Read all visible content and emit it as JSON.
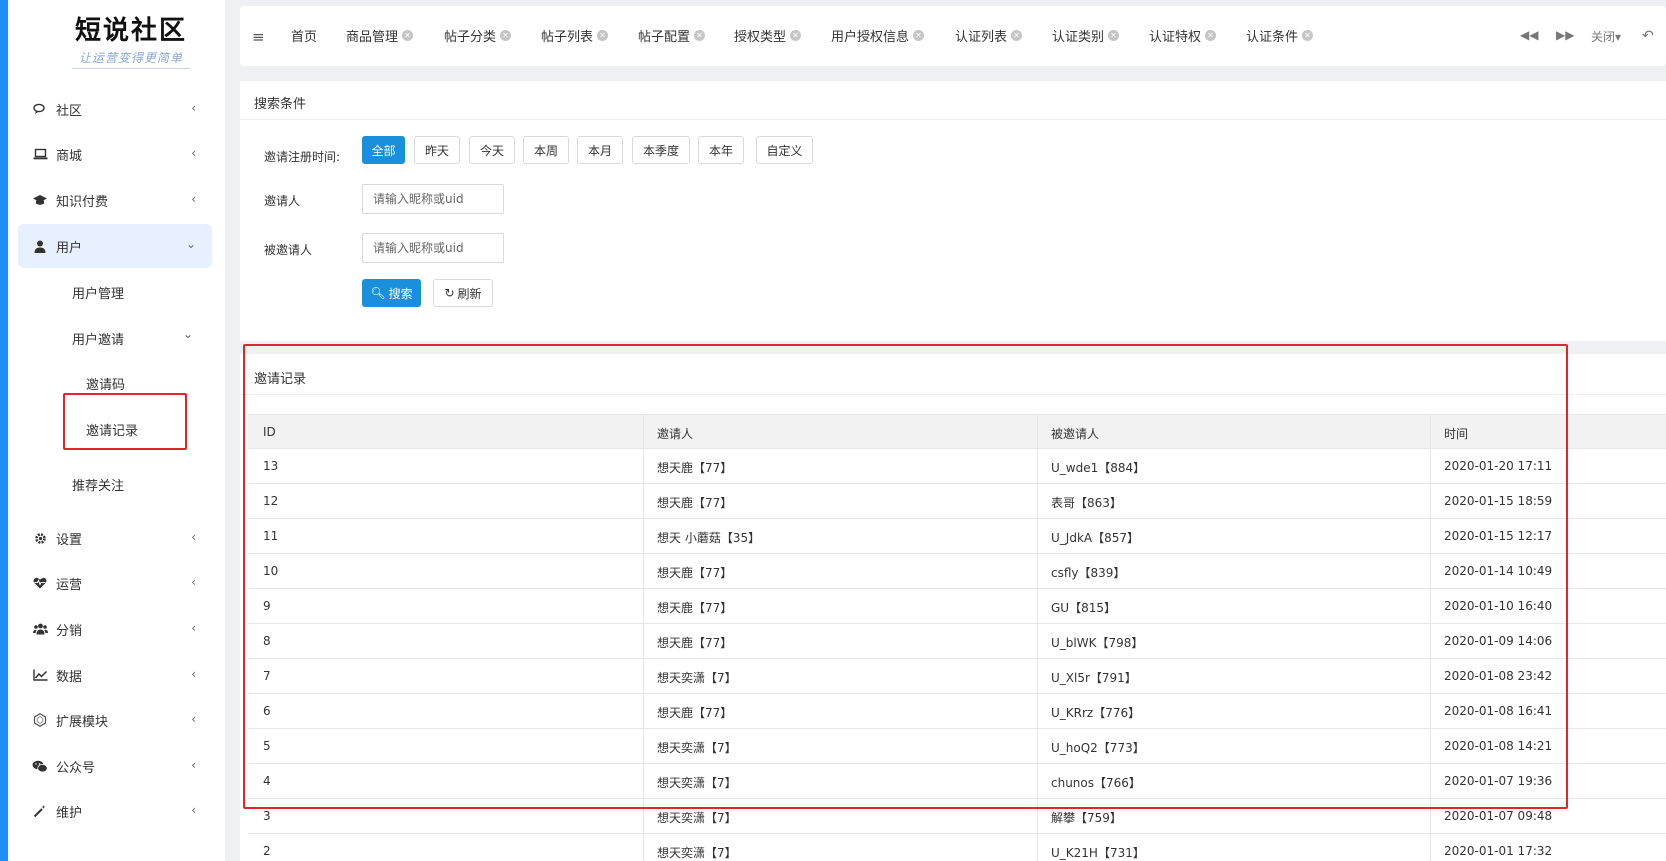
{
  "logo": {
    "title": "短说社区",
    "slogan": "让运营变得更简单"
  },
  "sidebar": {
    "items": [
      {
        "label": "社区",
        "icon": "chat-bubbles-icon"
      },
      {
        "label": "商城",
        "icon": "laptop-icon"
      },
      {
        "label": "知识付费",
        "icon": "graduation-cap-icon"
      },
      {
        "label": "用户",
        "icon": "user-icon"
      },
      {
        "label": "设置",
        "icon": "gear-icon"
      },
      {
        "label": "运营",
        "icon": "heartbeat-icon"
      },
      {
        "label": "分销",
        "icon": "users-group-icon"
      },
      {
        "label": "数据",
        "icon": "line-chart-icon"
      },
      {
        "label": "扩展模块",
        "icon": "hexagon-icon"
      },
      {
        "label": "公众号",
        "icon": "wechat-icon"
      },
      {
        "label": "维护",
        "icon": "magic-wand-icon"
      }
    ],
    "user_sub": {
      "user_mgmt": "用户管理",
      "invite": "用户邀请",
      "invite_code": "邀请码",
      "invite_record": "邀请记录",
      "recommend": "推荐关注"
    }
  },
  "tabs": [
    "首页",
    "商品管理",
    "帖子分类",
    "帖子列表",
    "帖子配置",
    "授权类型",
    "用户授权信息",
    "认证列表",
    "认证类别",
    "认证特权",
    "认证条件"
  ],
  "tabbar_right": {
    "close": "关闭"
  },
  "search": {
    "title": "搜索条件",
    "time_label": "邀请注册时间:",
    "time_options": [
      "全部",
      "昨天",
      "今天",
      "本周",
      "本月",
      "本季度",
      "本年",
      "自定义"
    ],
    "inviter_label": "邀请人",
    "invitee_label": "被邀请人",
    "placeholder": "请输入昵称或uid",
    "search_btn": "搜索",
    "refresh_btn": "刷新"
  },
  "records": {
    "title": "邀请记录",
    "columns": [
      "ID",
      "邀请人",
      "被邀请人",
      "时间"
    ],
    "rows": [
      [
        "13",
        "想天鹿【77】",
        "U_wde1【884】",
        "2020-01-20 17:11"
      ],
      [
        "12",
        "想天鹿【77】",
        "表哥【863】",
        "2020-01-15 18:59"
      ],
      [
        "11",
        "想天 小蘑菇【35】",
        "U_JdkA【857】",
        "2020-01-15 12:17"
      ],
      [
        "10",
        "想天鹿【77】",
        "csfly【839】",
        "2020-01-14 10:49"
      ],
      [
        "9",
        "想天鹿【77】",
        "GU【815】",
        "2020-01-10 16:40"
      ],
      [
        "8",
        "想天鹿【77】",
        "U_blWK【798】",
        "2020-01-09 14:06"
      ],
      [
        "7",
        "想天奕潇【7】",
        "U_Xl5r【791】",
        "2020-01-08 23:42"
      ],
      [
        "6",
        "想天鹿【77】",
        "U_KRrz【776】",
        "2020-01-08 16:41"
      ],
      [
        "5",
        "想天奕潇【7】",
        "U_hoQ2【773】",
        "2020-01-08 14:21"
      ],
      [
        "4",
        "想天奕潇【7】",
        "chunos【766】",
        "2020-01-07 19:36"
      ],
      [
        "3",
        "想天奕潇【7】",
        "解攀【759】",
        "2020-01-07 09:48"
      ],
      [
        "2",
        "想天奕潇【7】",
        "U_K21H【731】",
        "2020-01-01 17:32"
      ]
    ]
  },
  "colors": {
    "accent": "#1a8fdb",
    "highlight_box": "#e0252b",
    "sidebar_edge": "#1e8ff5"
  }
}
